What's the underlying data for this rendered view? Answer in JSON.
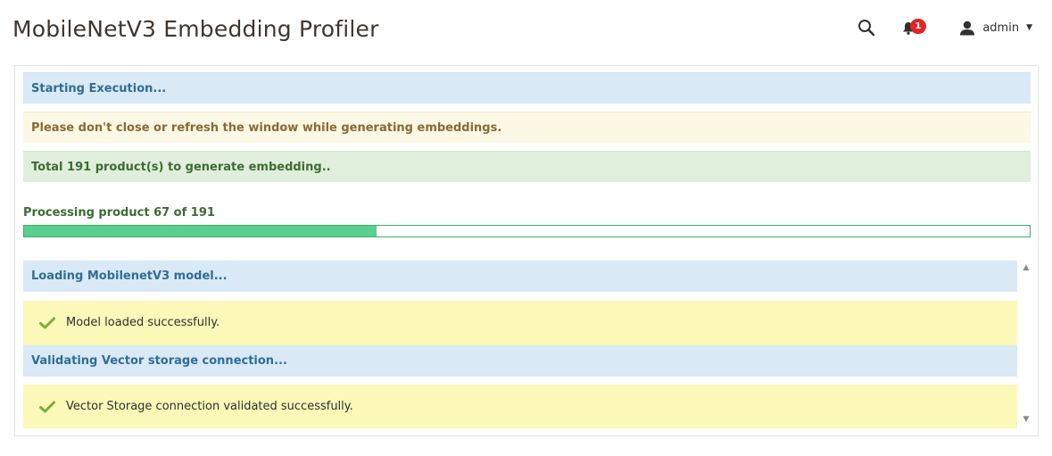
{
  "header": {
    "title": "MobileNetV3 Embedding Profiler",
    "notifications_count": "1",
    "user_name": "admin",
    "icons": {
      "search": "search-icon",
      "notifications": "bell-icon",
      "user": "user-icon",
      "dropdown": "caret-down-icon"
    }
  },
  "messages": [
    {
      "text": "Starting Execution...",
      "kind": "info"
    },
    {
      "text": "Please don't close or refresh the window while generating embeddings.",
      "kind": "warning"
    },
    {
      "text": "Total 191 product(s) to generate embedding..",
      "kind": "success"
    }
  ],
  "progress": {
    "label": "Processing product 67 of 191",
    "current": 67,
    "total": 191,
    "fill_color": "#5ad08f",
    "border_color": "#3fae69"
  },
  "log": [
    {
      "text": "Loading MobilenetV3 model...",
      "kind": "heading"
    },
    {
      "text": "Model loaded successfully.",
      "kind": "ok",
      "icon": "check-icon"
    },
    {
      "text": "Validating Vector storage connection...",
      "kind": "heading"
    },
    {
      "text": "Vector Storage connection validated successfully.",
      "kind": "ok",
      "icon": "check-icon"
    }
  ],
  "colors": {
    "info_bg": "#d9e9f5",
    "warning_bg": "#fcf8e6",
    "success_bg": "#e0efdb",
    "ok_bg": "#fbf8b8",
    "check": "#7aae3a",
    "badge": "#e22626"
  }
}
